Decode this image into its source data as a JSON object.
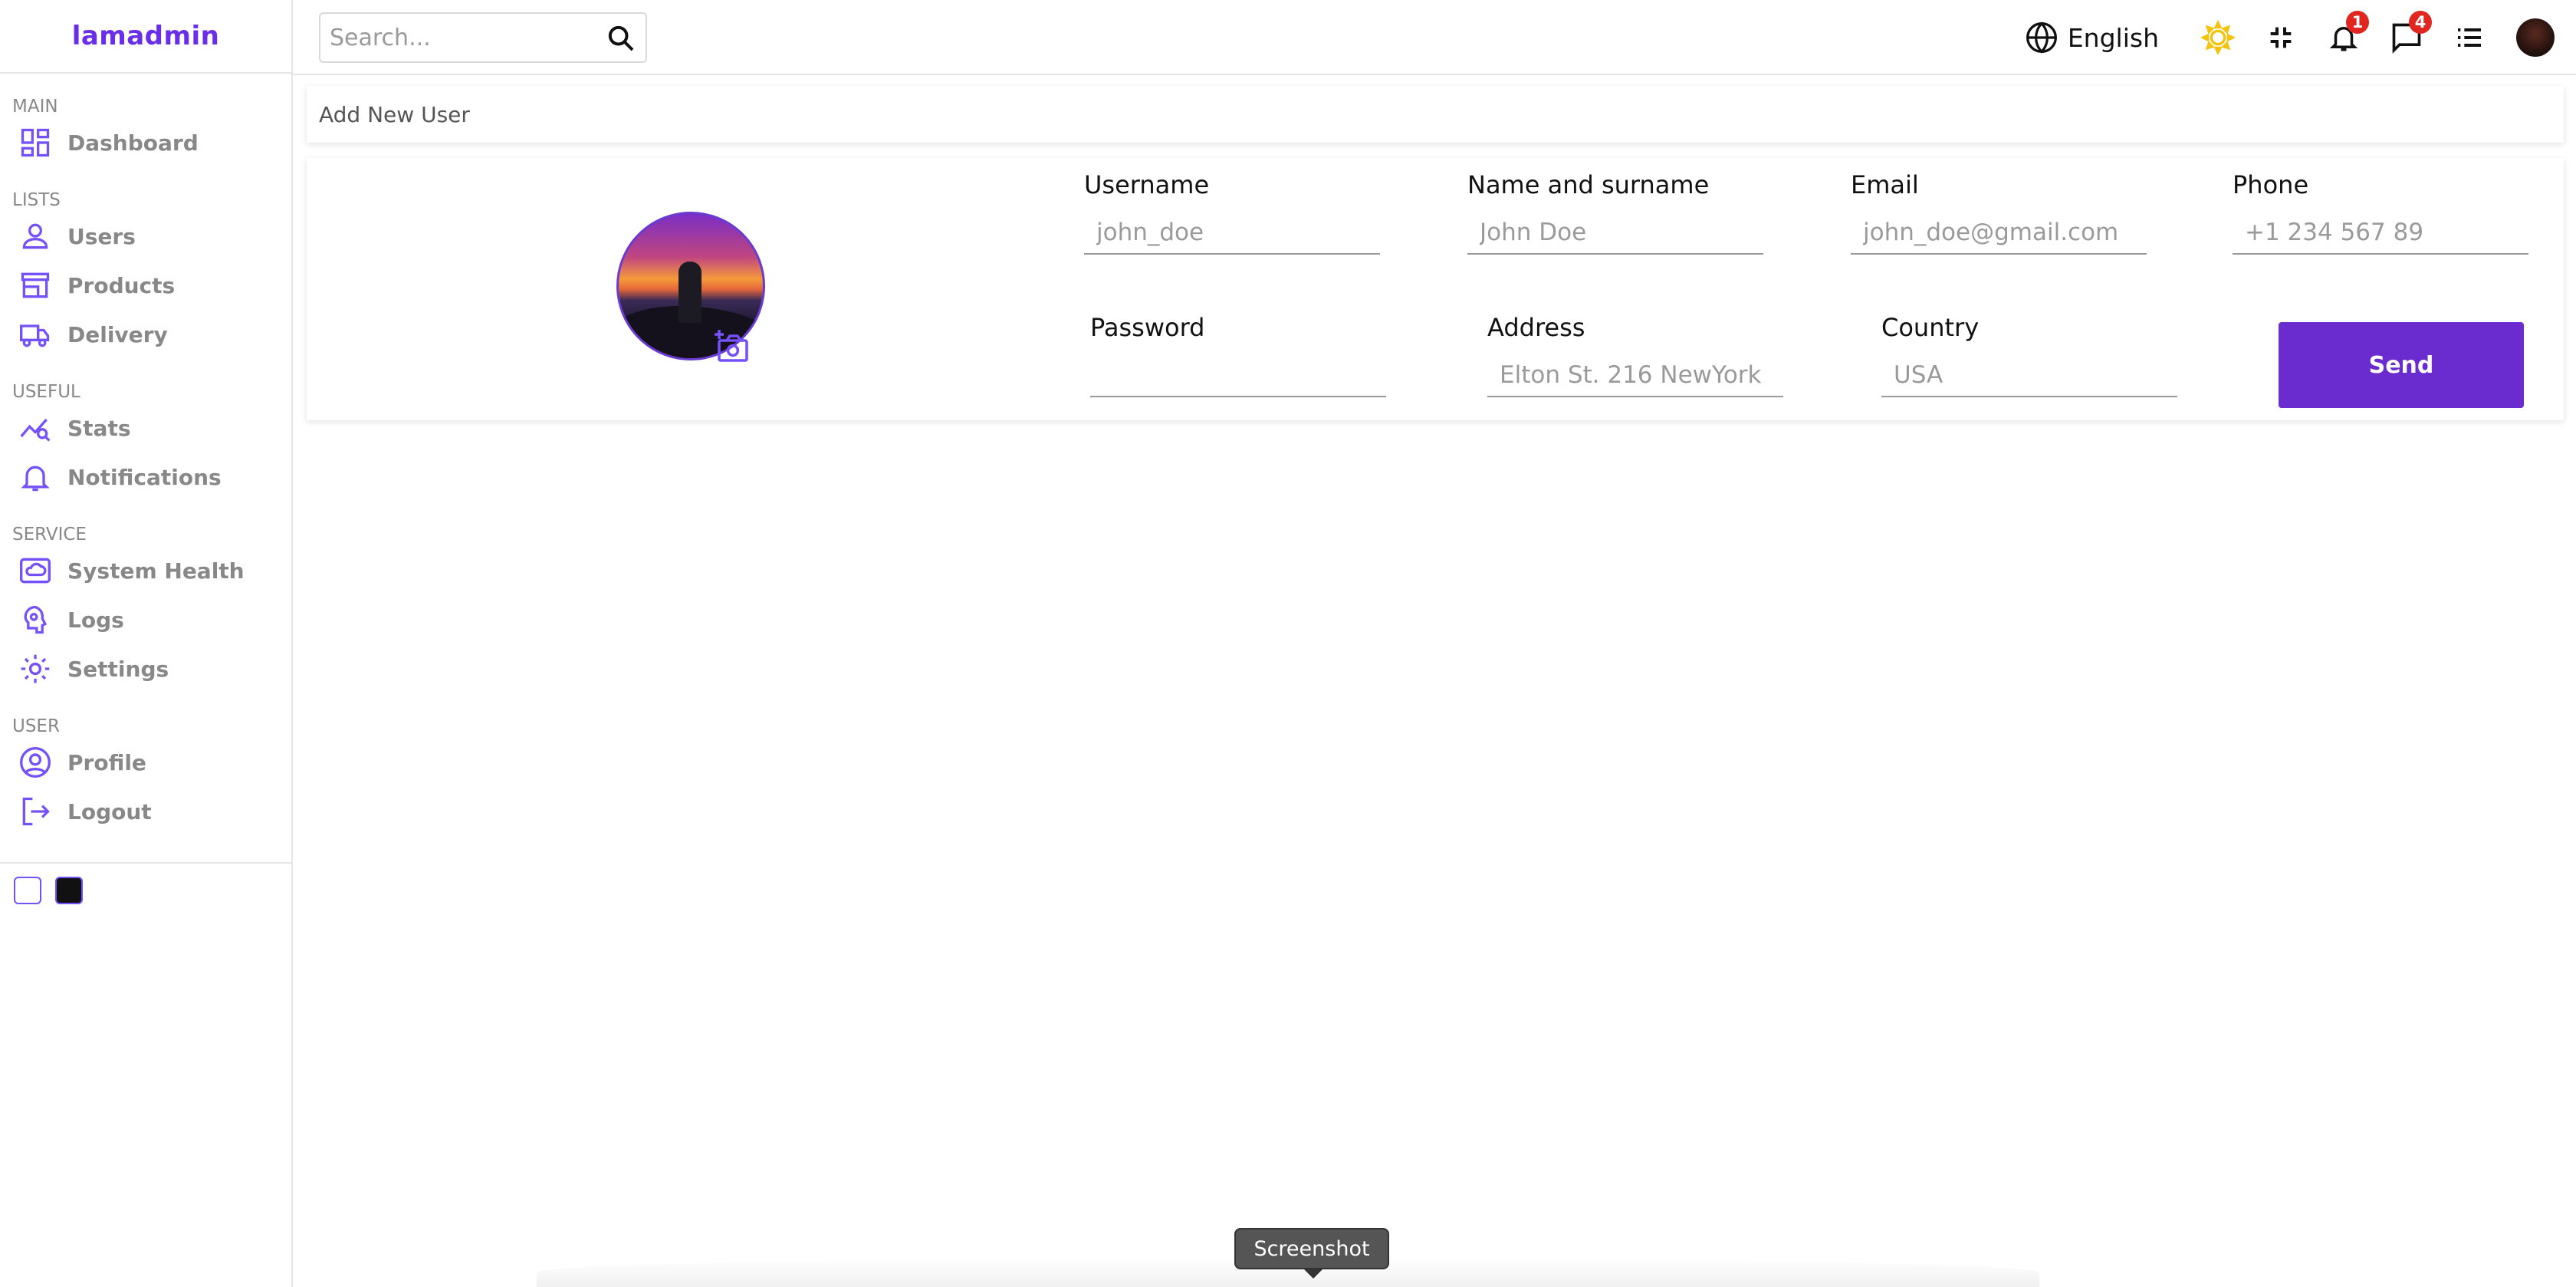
{
  "app": {
    "logo": "lamadmin"
  },
  "sidebar": {
    "sections": [
      {
        "title": "MAIN",
        "items": [
          {
            "label": "Dashboard",
            "icon": "dashboard-icon"
          }
        ]
      },
      {
        "title": "LISTS",
        "items": [
          {
            "label": "Users",
            "icon": "person-icon"
          },
          {
            "label": "Products",
            "icon": "store-icon"
          },
          {
            "label": "Delivery",
            "icon": "truck-icon"
          }
        ]
      },
      {
        "title": "USEFUL",
        "items": [
          {
            "label": "Stats",
            "icon": "stats-icon"
          },
          {
            "label": "Notifications",
            "icon": "bell-icon"
          }
        ]
      },
      {
        "title": "SERVICE",
        "items": [
          {
            "label": "System Health",
            "icon": "cloud-icon"
          },
          {
            "label": "Logs",
            "icon": "brain-icon"
          },
          {
            "label": "Settings",
            "icon": "gear-icon"
          }
        ]
      },
      {
        "title": "USER",
        "items": [
          {
            "label": "Profile",
            "icon": "account-circle-icon"
          },
          {
            "label": "Logout",
            "icon": "logout-icon"
          }
        ]
      }
    ],
    "theme_options": [
      "light",
      "dark"
    ]
  },
  "topbar": {
    "search_placeholder": "Search...",
    "language": "English",
    "notifications_count": "1",
    "messages_count": "4"
  },
  "page": {
    "title": "Add New User"
  },
  "form": {
    "fields": [
      {
        "label": "Username",
        "placeholder": "john_doe"
      },
      {
        "label": "Name and surname",
        "placeholder": "John Doe"
      },
      {
        "label": "Email",
        "placeholder": "john_doe@gmail.com"
      },
      {
        "label": "Phone",
        "placeholder": "+1 234 567 89"
      },
      {
        "label": "Password",
        "placeholder": ""
      },
      {
        "label": "Address",
        "placeholder": "Elton St. 216 NewYork"
      },
      {
        "label": "Country",
        "placeholder": "USA"
      }
    ],
    "submit_label": "Send"
  },
  "tooltip": {
    "text": "Screenshot"
  },
  "colors": {
    "accent": "#6a2ccf",
    "icon": "#7451f8",
    "badge": "#e0261f",
    "sun": "#f2c40f"
  }
}
